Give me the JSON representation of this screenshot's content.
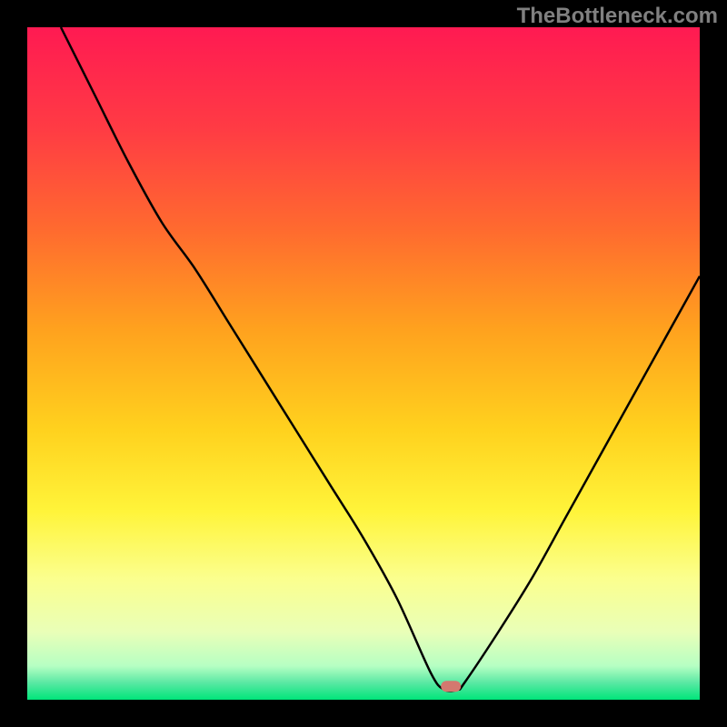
{
  "watermark": "TheBottleneck.com",
  "chart_data": {
    "type": "line",
    "title": "",
    "xlabel": "",
    "ylabel": "",
    "xlim": [
      0,
      100
    ],
    "ylim": [
      0,
      100
    ],
    "background": {
      "type": "vertical-gradient",
      "stops": [
        {
          "offset": 0.0,
          "color": "#ff1a52"
        },
        {
          "offset": 0.15,
          "color": "#ff3b44"
        },
        {
          "offset": 0.3,
          "color": "#ff6a2f"
        },
        {
          "offset": 0.45,
          "color": "#ffa21e"
        },
        {
          "offset": 0.6,
          "color": "#ffd21e"
        },
        {
          "offset": 0.72,
          "color": "#fff43a"
        },
        {
          "offset": 0.82,
          "color": "#fbff8e"
        },
        {
          "offset": 0.9,
          "color": "#e9ffb8"
        },
        {
          "offset": 0.95,
          "color": "#b6ffc3"
        },
        {
          "offset": 0.975,
          "color": "#59e8a3"
        },
        {
          "offset": 1.0,
          "color": "#00e57a"
        }
      ]
    },
    "optimum_marker": {
      "x": 63,
      "y": 98,
      "color": "#d4786f"
    },
    "series": [
      {
        "name": "bottleneck-curve",
        "color": "#000000",
        "x": [
          5,
          10,
          15,
          20,
          25,
          30,
          35,
          40,
          45,
          50,
          55,
          60,
          62,
          64,
          65,
          70,
          75,
          80,
          85,
          90,
          95,
          100
        ],
        "values": [
          0,
          10,
          20,
          29,
          36,
          44,
          52,
          60,
          68,
          76,
          85,
          96,
          98.5,
          98.5,
          97.5,
          90,
          82,
          73,
          64,
          55,
          46,
          37
        ]
      }
    ]
  }
}
